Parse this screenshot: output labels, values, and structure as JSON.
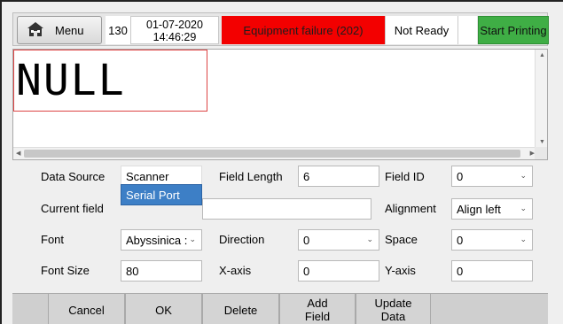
{
  "header": {
    "menu_label": "Menu",
    "count": "130",
    "date": "01-07-2020",
    "time": "14:46:29",
    "alert": "Equipment failure (202)",
    "status": "Not Ready",
    "start_label": "Start Printing",
    "icons": {
      "menu": "home-icon"
    },
    "colors": {
      "alert_bg": "#f30000",
      "start_bg": "#3fae45"
    }
  },
  "canvas": {
    "field_text": "NULL"
  },
  "form": {
    "data_source": {
      "label": "Data Source",
      "value": "Scanner",
      "dropdown_option": "Serial Port"
    },
    "field_length": {
      "label": "Field Length",
      "value": "6"
    },
    "field_id": {
      "label": "Field ID",
      "value": "0"
    },
    "current_field": {
      "label": "Current field",
      "value": ""
    },
    "alignment": {
      "label": "Alignment",
      "value": "Align left"
    },
    "font": {
      "label": "Font",
      "value": "Abyssinica :"
    },
    "direction": {
      "label": "Direction",
      "value": "0"
    },
    "space": {
      "label": "Space",
      "value": "0"
    },
    "font_size": {
      "label": "Font Size",
      "value": "80"
    },
    "x_axis": {
      "label": "X-axis",
      "value": "0"
    },
    "y_axis": {
      "label": "Y-axis",
      "value": "0"
    }
  },
  "footer": {
    "cancel": "Cancel",
    "ok": "OK",
    "delete": "Delete",
    "add_field_1": "Add",
    "add_field_2": "Field",
    "update_1": "Update",
    "update_2": "Data"
  }
}
